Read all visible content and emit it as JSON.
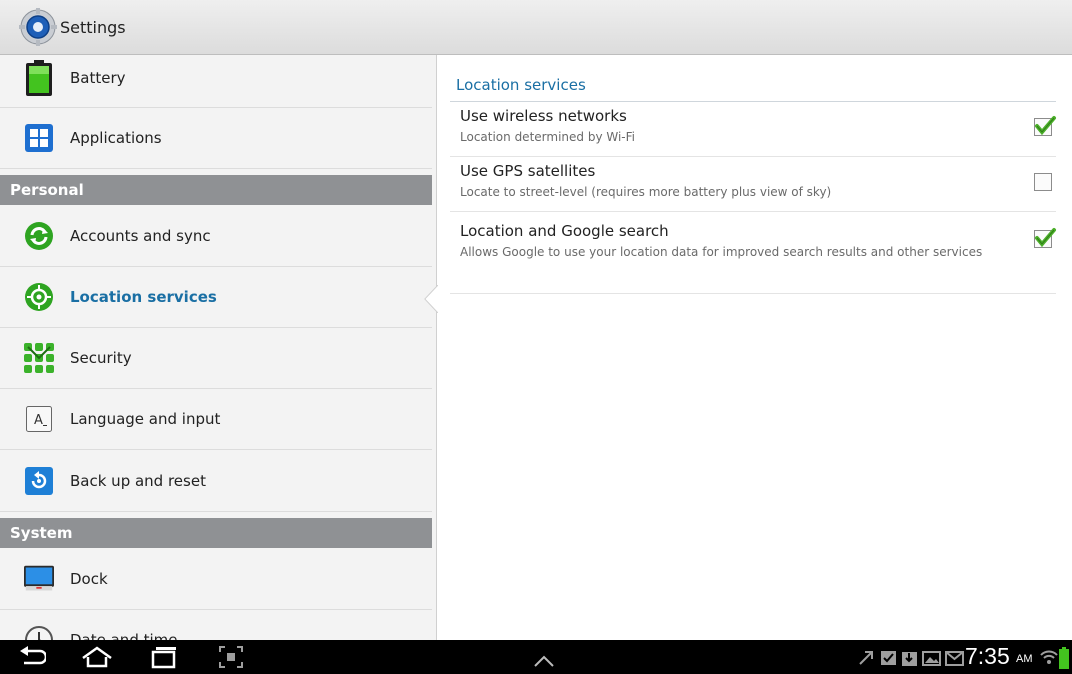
{
  "app": {
    "title": "Settings",
    "icon": "gear-icon"
  },
  "sidebar": {
    "items": [
      {
        "label": "Battery",
        "icon": "battery-icon"
      },
      {
        "label": "Applications",
        "icon": "applications-icon"
      },
      {
        "section": "Personal"
      },
      {
        "label": "Accounts and sync",
        "icon": "sync-icon"
      },
      {
        "label": "Location services",
        "icon": "location-icon",
        "selected": true
      },
      {
        "label": "Security",
        "icon": "security-icon"
      },
      {
        "label": "Language and input",
        "icon": "keyboard-icon"
      },
      {
        "label": "Back up and reset",
        "icon": "backup-icon"
      },
      {
        "section": "System"
      },
      {
        "label": "Dock",
        "icon": "dock-icon"
      },
      {
        "label": "Date and time",
        "icon": "clock-icon"
      }
    ]
  },
  "detail": {
    "title": "Location services",
    "prefs": [
      {
        "title": "Use wireless networks",
        "summary": "Location determined by Wi-Fi",
        "checked": true
      },
      {
        "title": "Use GPS satellites",
        "summary": "Locate to street-level (requires more battery plus view of sky)",
        "checked": false
      },
      {
        "title": "Location and Google search",
        "summary": "Allows Google to use your location data for improved search results and other services",
        "checked": true
      }
    ]
  },
  "system_bar": {
    "time": "7:35",
    "ampm": "AM",
    "buttons": [
      "back-icon",
      "home-icon",
      "recent-apps-icon",
      "screenshot-icon",
      "chevron-up-icon"
    ]
  },
  "colors": {
    "accent": "#1a6fa4",
    "section_header": "#8f9194",
    "check_green": "#4caf2a"
  }
}
